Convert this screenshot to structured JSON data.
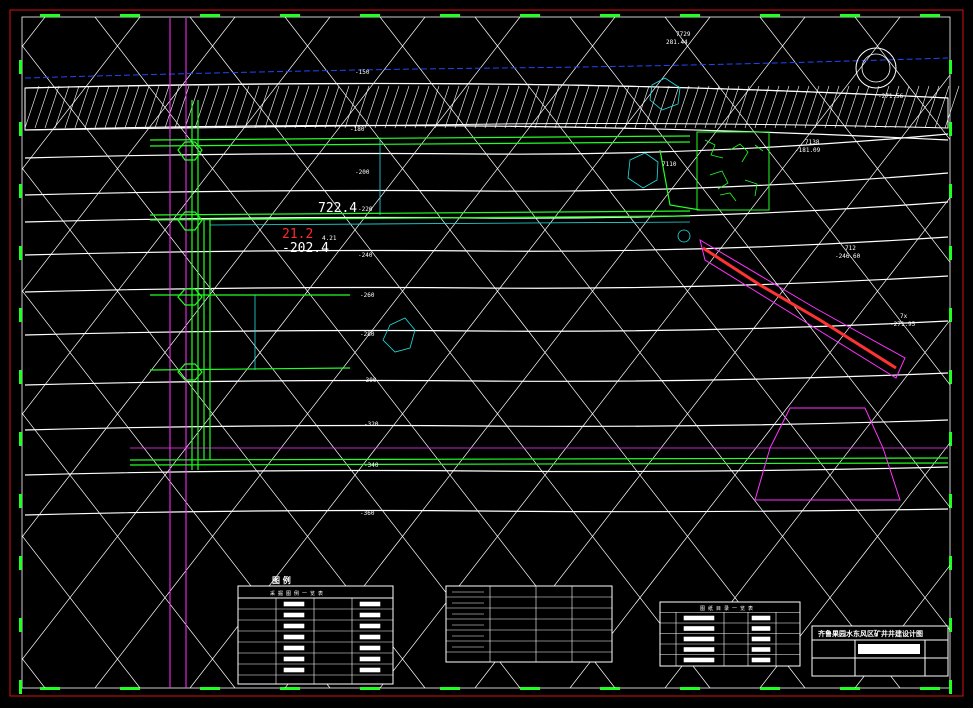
{
  "drawing": {
    "block_title": "齐鲁果园水东风区矿井井建设计图",
    "legend_title": "图 例",
    "legend_table_title": "采 掘 图 例 一 览 表",
    "catalog_title": "图 纸 目 录 一 览 表",
    "elevations": [
      "-150",
      "-180",
      "-200",
      "-220",
      "-240",
      "-260",
      "-280",
      "-300",
      "-320",
      "-340",
      "-360"
    ],
    "point_labels": {
      "p1": "7729",
      "p1b": "281.44",
      "p2": "7138",
      "p2b": "-181.09",
      "p3": "7110",
      "p4": "712",
      "p4b": "-246.60",
      "p5": "7x",
      "p5b": "-271.95",
      "top_right": "-271.56"
    },
    "red_mark": "21.2",
    "white_mark1": "722.4",
    "white_mark2": "-202.4",
    "white_mark3": "4.21",
    "bottom_note": "齐鲁果园水东风区矿井井建设计图"
  }
}
